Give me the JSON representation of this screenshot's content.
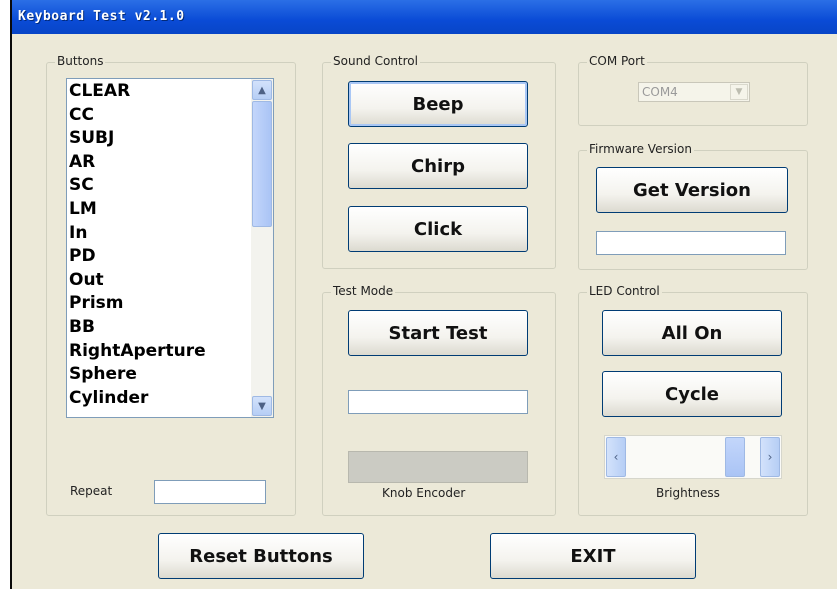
{
  "window": {
    "title": "Keyboard Test v2.1.0"
  },
  "buttons_group": {
    "legend": "Buttons",
    "items": [
      "CLEAR",
      "CC",
      "SUBJ",
      "AR",
      "SC",
      "LM",
      "In",
      "PD",
      "Out",
      "Prism",
      "BB",
      "RightAperture",
      "Sphere",
      "Cylinder"
    ],
    "repeat_label": "Repeat",
    "repeat_value": ""
  },
  "sound_control": {
    "legend": "Sound Control",
    "beep": "Beep",
    "chirp": "Chirp",
    "click": "Click"
  },
  "com_port": {
    "legend": "COM Port",
    "selected": "COM4"
  },
  "firmware": {
    "legend": "Firmware Version",
    "get_version": "Get Version",
    "version_value": ""
  },
  "test_mode": {
    "legend": "Test Mode",
    "start_test": "Start Test",
    "test_value": "",
    "knob_label": "Knob Encoder"
  },
  "led_control": {
    "legend": "LED Control",
    "all_on": "All On",
    "cycle": "Cycle",
    "brightness_label": "Brightness",
    "brightness_level": 0.85
  },
  "footer": {
    "reset": "Reset Buttons",
    "exit": "EXIT"
  }
}
